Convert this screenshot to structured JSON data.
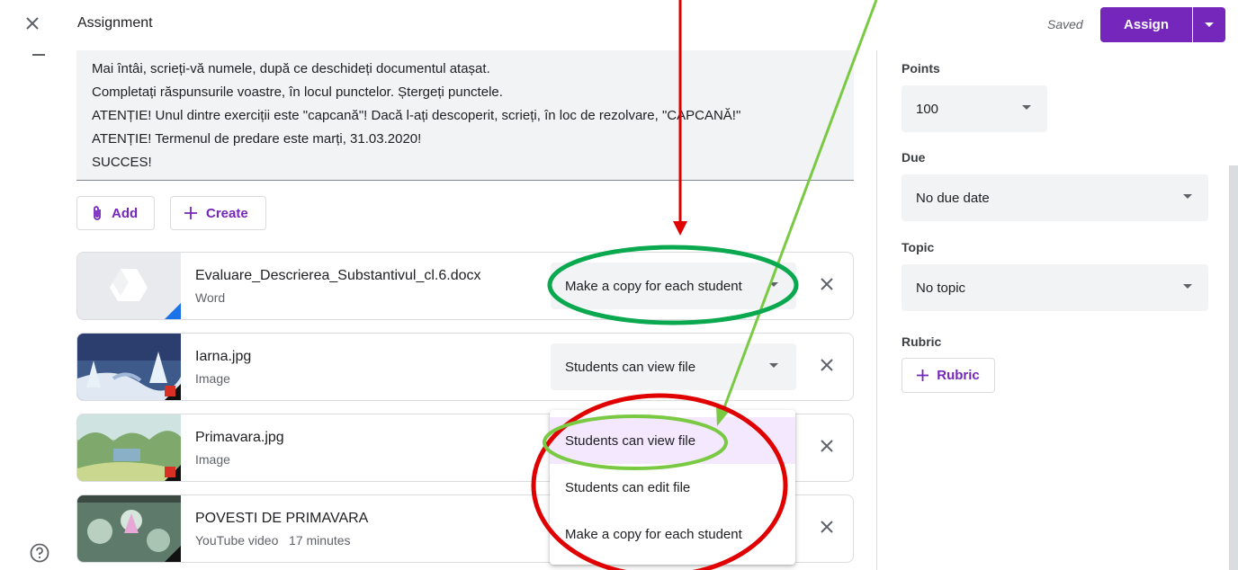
{
  "header": {
    "title": "Assignment",
    "saved": "Saved",
    "assign_label": "Assign"
  },
  "instructions": [
    "Mai întâi, scrieți-vă numele, după ce deschideți documentul atașat.",
    "Completați răspunsurile voastre, în locul punctelor. Ștergeți punctele.",
    "ATENȚIE! Unul dintre exerciții este \"capcană\"! Dacă l-ați descoperit, scrieți, în loc de rezolvare, \"CAPCANĂ!\"",
    "ATENȚIE! Termenul de predare este marți, 31.03.2020!",
    "SUCCES!"
  ],
  "toolbar": {
    "add_label": "Add",
    "create_label": "Create"
  },
  "attachments": [
    {
      "name": "Evaluare_Descrierea_Substantivul_cl.6.docx",
      "type": "Word",
      "permission": "Make a copy for each student"
    },
    {
      "name": "Iarna.jpg",
      "type": "Image",
      "permission": "Students can view file"
    },
    {
      "name": "Primavara.jpg",
      "type": "Image",
      "permission": ""
    },
    {
      "name": "POVESTI DE PRIMAVARA",
      "type": "YouTube video   17 minutes",
      "permission": ""
    }
  ],
  "permission_menu": {
    "options": [
      "Students can view file",
      "Students can edit file",
      "Make a copy for each student"
    ],
    "selected": "Students can view file"
  },
  "sidebar": {
    "points_label": "Points",
    "points_value": "100",
    "due_label": "Due",
    "due_value": "No due date",
    "topic_label": "Topic",
    "topic_value": "No topic",
    "rubric_label": "Rubric",
    "rubric_button": "Rubric"
  },
  "colors": {
    "accent": "#7627bb",
    "annotation_red": "#e00000",
    "annotation_green": "#0aa84f",
    "annotation_lightgreen": "#7ac943"
  }
}
